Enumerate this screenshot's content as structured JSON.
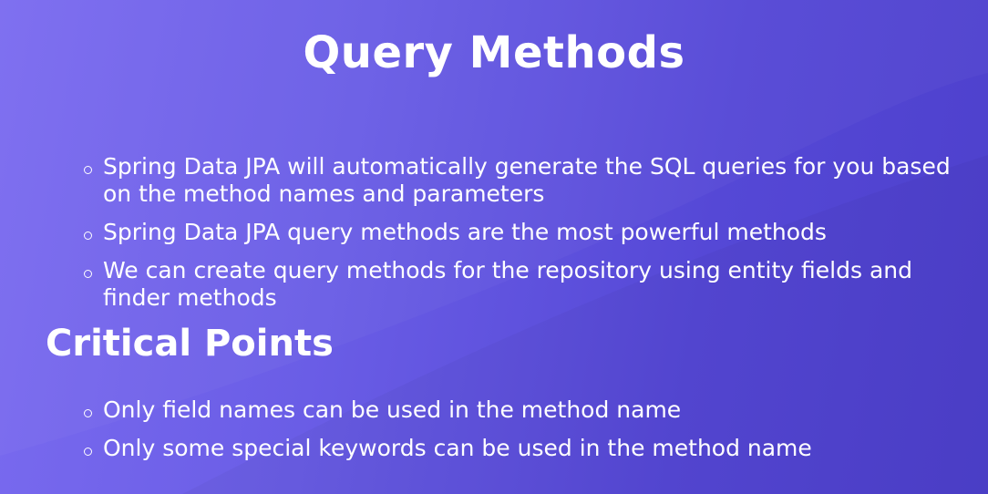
{
  "slide": {
    "title": "Query Methods",
    "main_points": [
      "Spring Data JPA will automatically generate the SQL queries for you based on the method names and parameters",
      "Spring Data JPA query methods are the most powerful methods",
      "We can create query methods for the repository using entity fields and finder methods"
    ],
    "critical_heading": "Critical Points",
    "critical_points": [
      "Only field names can be used in the method name",
      "Only some special keywords can be used in the method name"
    ]
  },
  "colors": {
    "background_start": "#7b6cf0",
    "background_end": "#4d40cc",
    "text": "#ffffff"
  },
  "icons": {
    "bullet": "hollow-circle-bullet-icon"
  }
}
